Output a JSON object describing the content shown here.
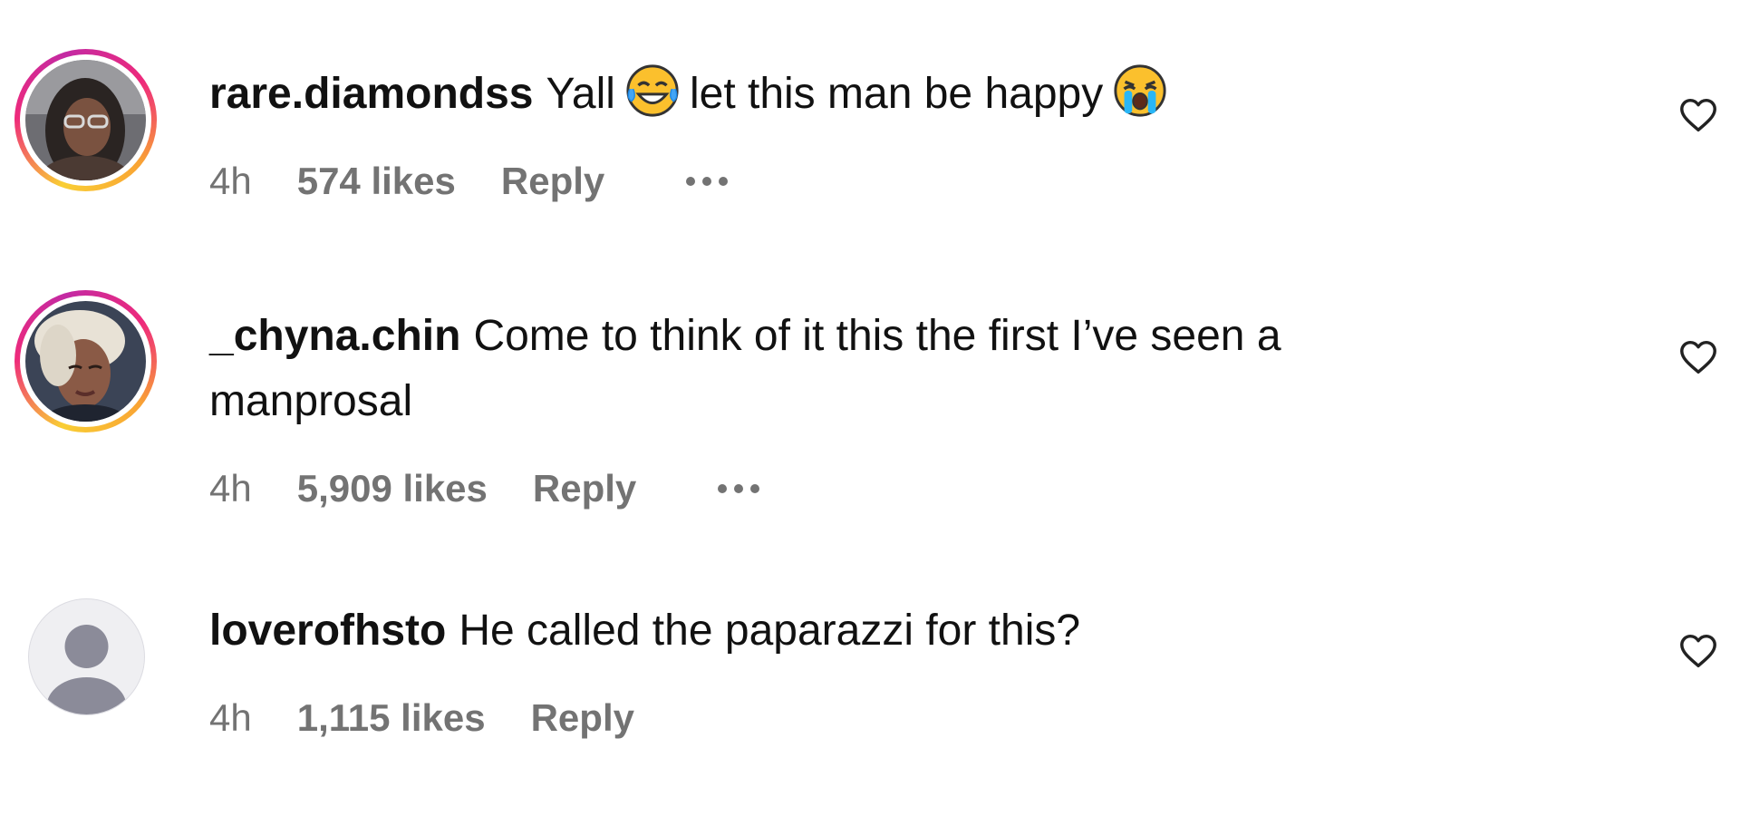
{
  "comments": [
    {
      "username": "rare.diamondss",
      "text_part1": "Yall",
      "emoji1": "face-with-tears-of-joy",
      "text_part2": "let this man be happy",
      "emoji2": "loudly-crying-face",
      "time": "4h",
      "likes": "574 likes",
      "reply": "Reply",
      "has_story_ring": true
    },
    {
      "username": "_chyna.chin",
      "text": "Come to think of it this the first I’ve seen a manprosal",
      "time": "4h",
      "likes": "5,909 likes",
      "reply": "Reply",
      "has_story_ring": true
    },
    {
      "username": "loverofhsto",
      "text": "He called the paparazzi for this?",
      "time": "4h",
      "likes": "1,115 likes",
      "reply": "Reply",
      "has_story_ring": false
    }
  ],
  "icons": {
    "like": "heart-outline-icon",
    "more": "more-horizontal-icon",
    "default_avatar": "default-user-icon"
  },
  "colors": {
    "ring_start": "#f9ce34",
    "ring_mid": "#ee2a7b",
    "ring_end": "#c32aa3",
    "meta_text": "#737373",
    "default_avatar_bg": "#efeff2",
    "default_avatar_fg": "#8b8b99"
  }
}
